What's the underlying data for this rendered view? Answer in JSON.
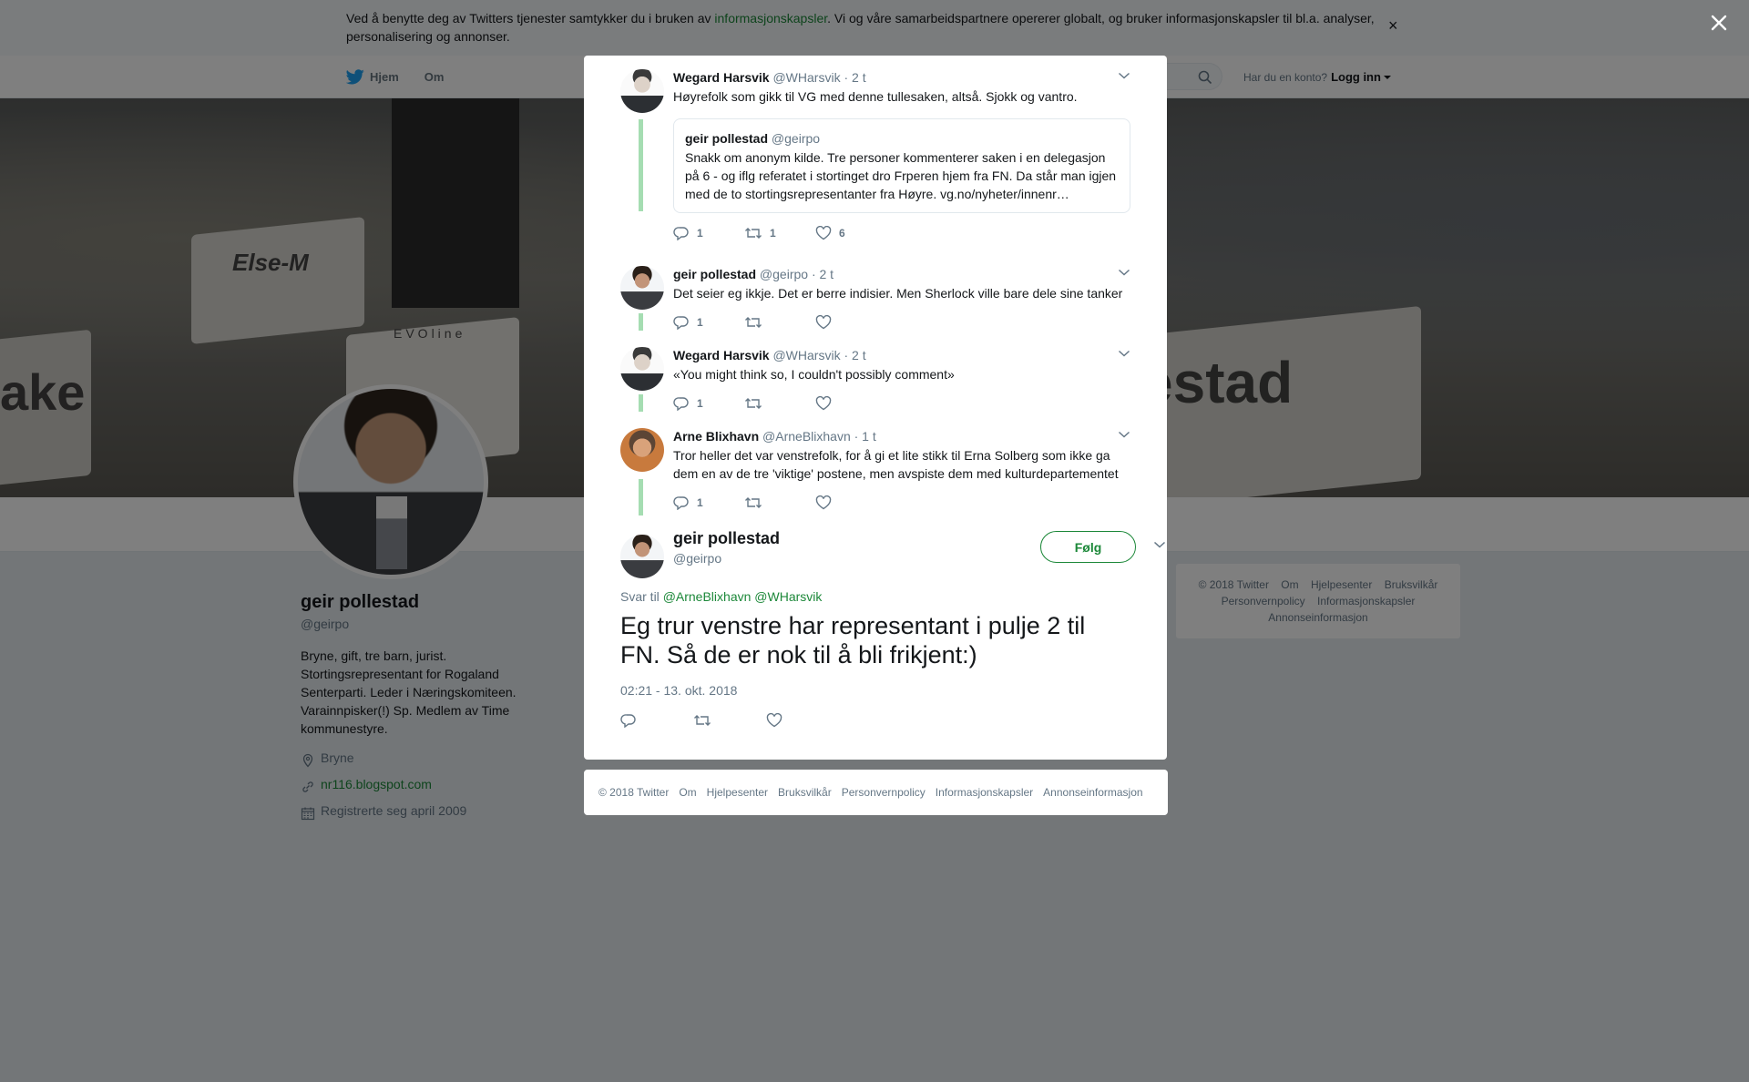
{
  "cookie_banner": {
    "text_before": "Ved å benytte deg av Twitters tjenester samtykker du i bruken av ",
    "link": "informasjonskapsler",
    "text_after": ". Vi og våre samarbeidspartnere opererer globalt, og bruker informasjonskapsler til bl.a. analyser, personalisering og annonser.",
    "close": "×"
  },
  "nav": {
    "home": "Hjem",
    "about": "Om",
    "account_prompt": "Har du en konto?",
    "login": "Logg inn"
  },
  "cover": {
    "text_left": "Else-M",
    "text_left2": "ake",
    "text_right": "estad",
    "brand": "EVOline"
  },
  "profile": {
    "name": "geir pollestad",
    "handle": "@geirpo",
    "bio": "Bryne, gift, tre barn, jurist. Stortingsrepresentant for Rogaland Senterparti. Leder i Næringskomiteen. Varainnpisker(!) Sp. Medlem av Time kommunestyre.",
    "location": "Bryne",
    "website": "nr116.blogspot.com",
    "joined": "Registrerte seg april 2009"
  },
  "side_footer": [
    "© 2018 Twitter",
    "Om",
    "Hjelpesenter",
    "Bruksvilkår",
    "Personvernpolicy",
    "Informasjonskapsler",
    "Annonseinformasjon"
  ],
  "thread": [
    {
      "name": "Wegard Harsvik",
      "handle": "@WHarsvik",
      "time": "· 2 t",
      "text": "Høyrefolk som gikk til VG med denne tullesaken, altså. Sjokk og vantro.",
      "quote": {
        "name": "geir pollestad",
        "handle": "@geirpo",
        "text": "Snakk om anonym kilde. Tre personer kommenterer saken i en delegasjon på 6 - og iflg referatet i stortinget dro Frperen hjem fra FN. Da står man igjen med de to stortingsrepresentanter fra Høyre. vg.no/nyheter/innenr…"
      },
      "replies": "1",
      "retweets": "1",
      "likes": "6"
    },
    {
      "name": "geir pollestad",
      "handle": "@geirpo",
      "time": "· 2 t",
      "text": "Det seier eg ikkje. Det er berre indisier. Men Sherlock ville bare dele sine tanker",
      "replies": "1",
      "retweets": "",
      "likes": ""
    },
    {
      "name": "Wegard Harsvik",
      "handle": "@WHarsvik",
      "time": "· 2 t",
      "text": "«You might think so, I couldn't possibly comment»",
      "replies": "1",
      "retweets": "",
      "likes": ""
    },
    {
      "name": "Arne Blixhavn",
      "handle": "@ArneBlixhavn",
      "time": "· 1 t",
      "text": "Tror heller det var venstrefolk, for å gi et lite stikk til Erna Solberg som ikke ga dem en av de tre 'viktige' postene, men avspiste dem med kulturdepartementet",
      "replies": "1",
      "retweets": "",
      "likes": ""
    }
  ],
  "main_tweet": {
    "name": "geir pollestad",
    "handle": "@geirpo",
    "follow": "Følg",
    "reply_prefix": "Svar til",
    "reply_to_1": "@ArneBlixhavn",
    "reply_to_2": "@WHarsvik",
    "text": "Eg trur venstre har representant i pulje 2 til FN. Så de er nok til å bli frikjent:)",
    "timestamp": "02:21 - 13. okt. 2018"
  },
  "modal_footer": [
    "© 2018 Twitter",
    "Om",
    "Hjelpesenter",
    "Bruksvilkår",
    "Personvernpolicy",
    "Informasjonskapsler",
    "Annonseinformasjon"
  ],
  "colors": {
    "accent": "#1c8839",
    "thread_line": "#a5ddb2",
    "twitter_blue": "#1da1f2"
  }
}
